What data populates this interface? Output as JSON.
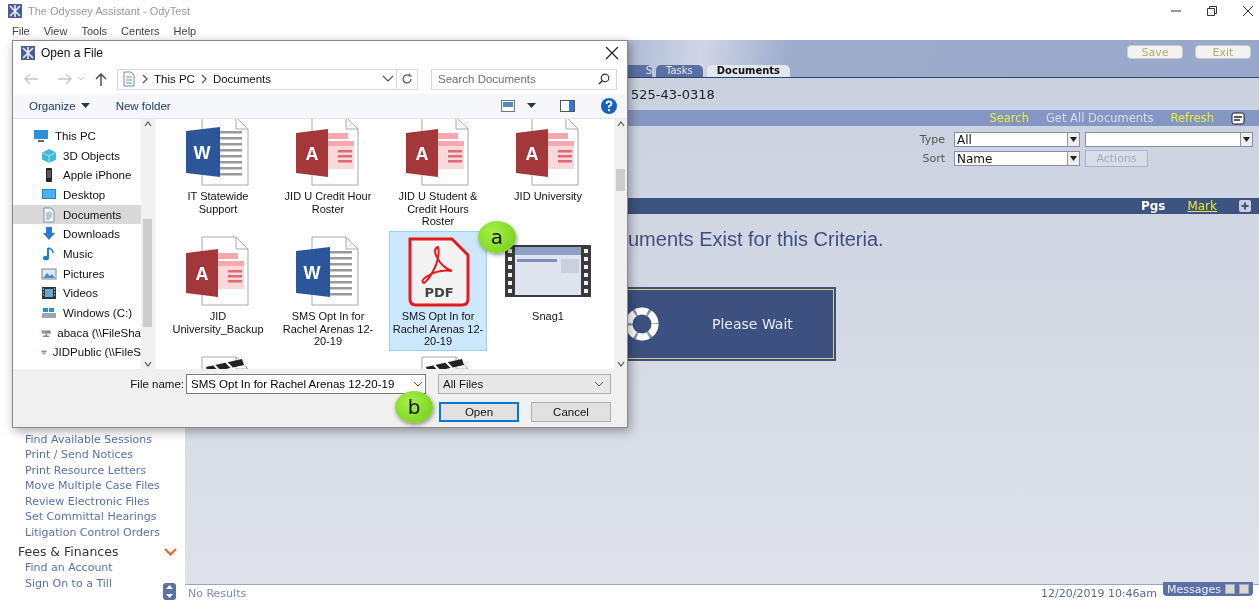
{
  "window": {
    "title": "The Odyssey Assistant - OdyTest"
  },
  "menu": [
    {
      "label": "File"
    },
    {
      "label": "View"
    },
    {
      "label": "Tools"
    },
    {
      "label": "Centers"
    },
    {
      "label": "Help"
    }
  ],
  "header": {
    "buttons": [
      {
        "label": "Save",
        "disabled": true
      },
      {
        "label": "Exit",
        "disabled": true
      }
    ]
  },
  "tabs": [
    {
      "label": "S",
      "selected": false
    },
    {
      "label": "Tasks",
      "selected": false
    },
    {
      "label": "Documents",
      "selected": true
    }
  ],
  "case_number": "525-43-0318",
  "link_bar": {
    "links": [
      {
        "label": "Search",
        "disabled": false
      },
      {
        "label": "Get All Documents",
        "disabled": true
      },
      {
        "label": "Refresh",
        "disabled": false
      }
    ]
  },
  "filters": {
    "type": {
      "label": "Type",
      "value": "All"
    },
    "sort": {
      "label": "Sort",
      "value": "Name"
    },
    "actions": {
      "label": "Actions",
      "disabled": true
    }
  },
  "list_header": {
    "columns": [
      {
        "label": "Pgs",
        "kind": "heading"
      },
      {
        "label": "Mark",
        "kind": "link"
      }
    ]
  },
  "message": "uments Exist for this Criteria.",
  "wait": {
    "label": "Please Wait"
  },
  "sidebar": {
    "items": [
      "Find Available Sessions",
      "Print / Send Notices",
      "Print Resource Letters",
      "Move Multiple Case Files",
      "Review Electronic Files",
      "Set Committal Hearings",
      "Litigation Control Orders"
    ],
    "sections": [
      {
        "heading": "Fees & Finances",
        "expanded": true,
        "items": [
          "Find an Account",
          "Sign On to a Till"
        ]
      }
    ]
  },
  "status_bar": {
    "text": "No Results",
    "datetime": "12/20/2019 10:46am",
    "messages": "Messages"
  },
  "dialog": {
    "title": "Open a File",
    "path": [
      "This PC",
      "Documents"
    ],
    "search": {
      "placeholder": "Search Documents"
    },
    "toolbar": {
      "organize": "Organize",
      "new_folder": "New folder"
    },
    "nav": [
      {
        "label": "This PC",
        "kind": "pc",
        "selected": false,
        "children": [
          {
            "label": "3D Objects",
            "kind": "cube",
            "selected": false
          },
          {
            "label": "Apple iPhone",
            "kind": "phone",
            "selected": false
          },
          {
            "label": "Desktop",
            "kind": "desktop",
            "selected": false
          },
          {
            "label": "Documents",
            "kind": "documents",
            "selected": true
          },
          {
            "label": "Downloads",
            "kind": "downloads",
            "selected": false
          },
          {
            "label": "Music",
            "kind": "music",
            "selected": false
          },
          {
            "label": "Pictures",
            "kind": "pictures",
            "selected": false
          },
          {
            "label": "Videos",
            "kind": "videos",
            "selected": false
          },
          {
            "label": "Windows (C:)",
            "kind": "drive",
            "selected": false
          },
          {
            "label": "abaca (\\\\FileSha",
            "kind": "network",
            "selected": false
          },
          {
            "label": "JIDPublic (\\\\FileS",
            "kind": "network",
            "selected": false
          }
        ]
      }
    ],
    "files": [
      {
        "name": "IT Statewide Support",
        "kind": "word",
        "icon_text": "W",
        "selected": false
      },
      {
        "name": "JID U Credit Hour Roster",
        "kind": "access",
        "icon_text": "A",
        "selected": false
      },
      {
        "name": "JID U Student & Credit Hours Roster",
        "kind": "access",
        "icon_text": "A",
        "selected": false
      },
      {
        "name": "JID University",
        "kind": "access",
        "icon_text": "A",
        "selected": false
      },
      {
        "name": "JID University_Backup",
        "kind": "access",
        "icon_text": "A",
        "selected": false
      },
      {
        "name": "SMS Opt In for Rachel Arenas 12-20-19",
        "kind": "word",
        "icon_text": "W",
        "selected": false
      },
      {
        "name": "SMS Opt In for Rachel Arenas 12-20-19",
        "kind": "pdf",
        "icon_text": "PDF",
        "selected": true
      },
      {
        "name": "Snag1",
        "kind": "video",
        "selected": false
      }
    ],
    "partly_shown": [
      {
        "kind": "clip"
      },
      {
        "kind": "clip"
      }
    ],
    "file_name": {
      "label": "File name:",
      "value": "SMS Opt In for Rachel Arenas 12-20-19"
    },
    "filter": {
      "value": "All Files"
    },
    "buttons": [
      {
        "label": "Open",
        "default": true
      },
      {
        "label": "Cancel",
        "default": false
      }
    ]
  },
  "callouts": [
    {
      "label": "a"
    },
    {
      "label": "b"
    }
  ]
}
